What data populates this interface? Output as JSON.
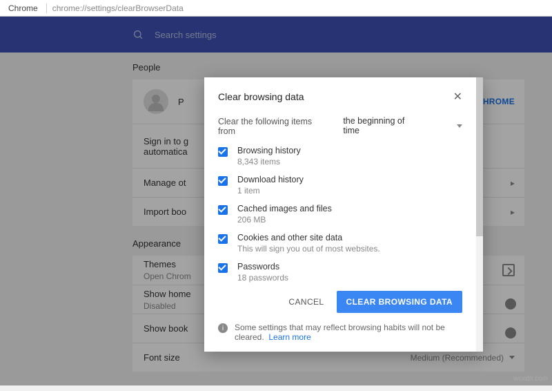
{
  "address_bar": {
    "browser": "Chrome",
    "url": "chrome://settings/clearBrowserData"
  },
  "header": {
    "search_placeholder": "Search settings"
  },
  "sections": {
    "people": {
      "title": "People",
      "row0_text": "P",
      "sign_in_link": "O CHROME",
      "row1_text": "Sign in to g\nautomatica",
      "row2_text": "Manage ot",
      "row3_text": "Import boo"
    },
    "appearance": {
      "title": "Appearance",
      "themes": {
        "label": "Themes",
        "sub": "Open Chrom"
      },
      "show_home": {
        "label": "Show home",
        "sub": "Disabled"
      },
      "show_book": {
        "label": "Show book"
      },
      "font_size": {
        "label": "Font size",
        "value": "Medium (Recommended)"
      }
    }
  },
  "dialog": {
    "title": "Clear browsing data",
    "range_label": "Clear the following items from",
    "range_value": "the beginning of time",
    "options": [
      {
        "label": "Browsing history",
        "sub": "8,343 items"
      },
      {
        "label": "Download history",
        "sub": "1 item"
      },
      {
        "label": "Cached images and files",
        "sub": "206 MB"
      },
      {
        "label": "Cookies and other site data",
        "sub": "This will sign you out of most websites."
      },
      {
        "label": "Passwords",
        "sub": "18 passwords"
      }
    ],
    "cancel": "CANCEL",
    "confirm": "CLEAR BROWSING DATA",
    "note": "Some settings that may reflect browsing habits will not be cleared.",
    "learn_more": "Learn more"
  },
  "watermark": "wsxdn.com"
}
